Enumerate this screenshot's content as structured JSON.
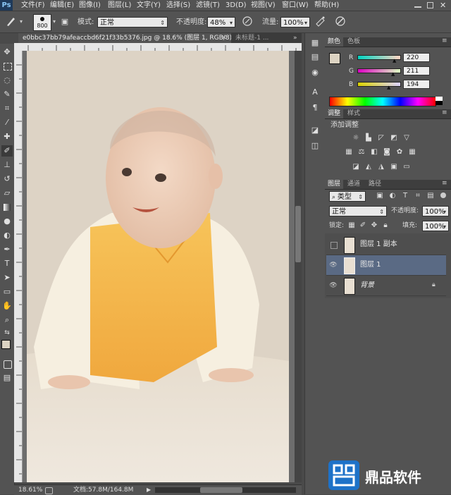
{
  "menubar": {
    "logo": "Ps",
    "items": [
      "文件(F)",
      "编辑(E)",
      "图像(I)",
      "图层(L)",
      "文字(Y)",
      "选择(S)",
      "滤镜(T)",
      "3D(D)",
      "视图(V)",
      "窗口(W)",
      "帮助(H)"
    ]
  },
  "options": {
    "brush_size": "800",
    "mode_label": "模式:",
    "mode_value": "正常",
    "opacity_label": "不透明度:",
    "opacity_value": "48%",
    "flow_label": "流量:",
    "flow_value": "100%"
  },
  "tabs": {
    "active": "e0bbc37bb79afeaccbd6f21f33b5376.jpg @ 18.6% (图层 1, RGB/8) *",
    "inactive": "未标题-1 ...",
    "more": "»"
  },
  "status": {
    "zoom": "18.61%",
    "doc": "文档:57.8M/164.8M"
  },
  "color_panel": {
    "tabs": [
      "颜色",
      "色板"
    ],
    "r_label": "R",
    "r_value": "220",
    "g_label": "G",
    "g_value": "211",
    "b_label": "B",
    "b_value": "194",
    "fg_color": "#dcd3c2"
  },
  "adjust_panel": {
    "tabs": [
      "调整",
      "样式"
    ],
    "title": "添加调整"
  },
  "layers_panel": {
    "tabs": [
      "图层",
      "通道",
      "路径"
    ],
    "kind": "类型",
    "blend_mode": "正常",
    "opacity_label": "不透明度:",
    "opacity_value": "100%",
    "lock_label": "锁定:",
    "fill_label": "填充:",
    "fill_value": "100%",
    "layers": [
      {
        "name": "图层 1 副本",
        "visible": false,
        "selected": false,
        "locked": false
      },
      {
        "name": "图层 1",
        "visible": true,
        "selected": true,
        "locked": false
      },
      {
        "name": "背景",
        "visible": true,
        "selected": false,
        "locked": true
      }
    ]
  },
  "watermark": {
    "text": "鼎品软件"
  }
}
